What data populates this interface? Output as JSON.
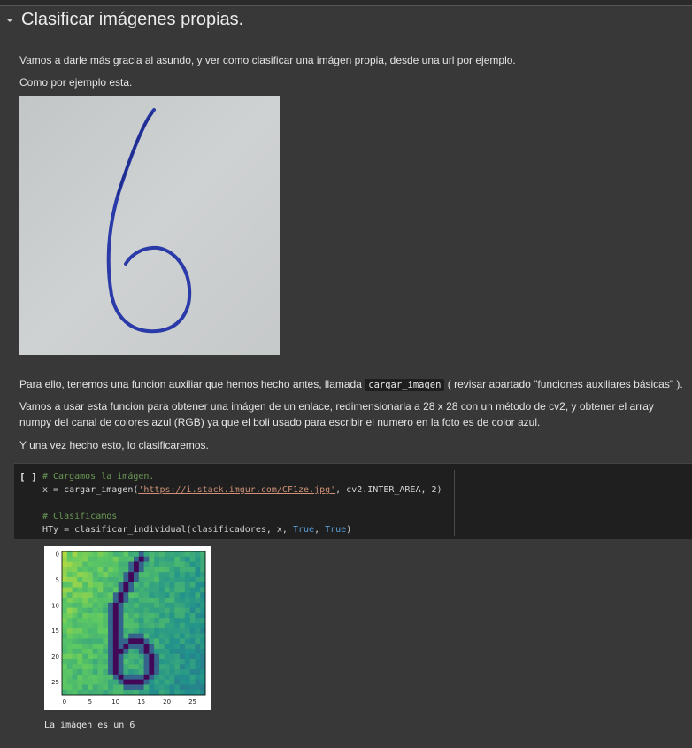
{
  "section": {
    "title": "Clasificar imágenes propias.",
    "intro": "Vamos a darle más gracia al asundo, y ver como clasificar una imágen propia, desde una url por ejemplo.",
    "example": "Como por ejemplo esta."
  },
  "explanation": {
    "p1_before": "Para ello, tenemos una funcion auxiliar que hemos hecho antes, llamada",
    "p1_code": "cargar_imagen",
    "p1_after": "( revisar apartado \"funciones auxiliares básicas\" ).",
    "p2": "Vamos a usar esta funcion para obtener una imágen de un enlace, redimensionarla a 28 x 28 con un método de cv2, y obtener el array numpy del canal de colores azul (RGB) ya que el boli usado para escribir el numero en la foto es de color azul.",
    "p3": "Y una vez hecho esto, lo clasificaremos."
  },
  "cell": {
    "run_indicator": "[ ]",
    "line1": "# Cargamos la imágen.",
    "line2_a": "x = cargar_imagen(",
    "line2_url": "'https://i.stack.imgur.com/CF1ze.jpg'",
    "line2_b": ", cv2.INTER_AREA, 2)",
    "line4": "# Clasificamos",
    "line5_a": "HTy = clasificar_individual(clasificadores, x, ",
    "line5_kw1": "True",
    "line5_sep": ", ",
    "line5_kw2": "True",
    "line5_b": ")"
  },
  "output": {
    "text": "La imágen es un 6"
  },
  "chart_data": {
    "type": "heatmap",
    "title": "",
    "xlabel": "",
    "ylabel": "",
    "xlim": [
      0,
      27
    ],
    "ylim": [
      27,
      0
    ],
    "x_ticks": [
      "0",
      "5",
      "10",
      "15",
      "20",
      "25"
    ],
    "y_ticks": [
      "0",
      "5",
      "10",
      "15",
      "20",
      "25"
    ],
    "colormap": "viridis",
    "grid": false
  },
  "colors": {
    "background": "#383838",
    "cell_background": "#1f1f1f",
    "comment": "#6a9955",
    "string": "#ce9178",
    "keyword": "#569cd6"
  }
}
